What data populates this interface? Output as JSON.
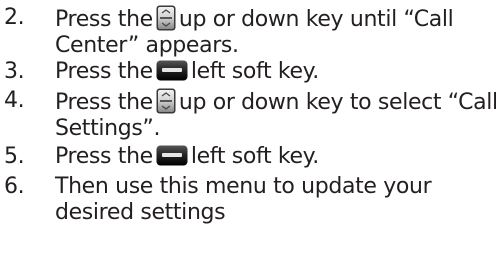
{
  "steps": [
    {
      "number": "2.",
      "prefix": "Press the",
      "icon": "nav-key-icon",
      "line1_rest": "up or down key until “Call",
      "line2": "Center” appears."
    },
    {
      "number": "3.",
      "prefix": "Press the",
      "icon": "soft-key-icon",
      "line1_rest": "left soft key."
    },
    {
      "number": "4.",
      "prefix": "Press the",
      "icon": "nav-key-icon",
      "line1_rest": "up or down key to select “Call",
      "line2": "Settings”."
    },
    {
      "number": "5.",
      "prefix": "Press the",
      "icon": "soft-key-icon",
      "line1_rest": "left soft key."
    },
    {
      "number": "6.",
      "line1": "Then use this menu to update your",
      "line2": "desired settings"
    }
  ],
  "colors": {
    "text": "#231f20",
    "icon_dark": "#2b2b2b",
    "icon_light": "#e6e6e6"
  }
}
